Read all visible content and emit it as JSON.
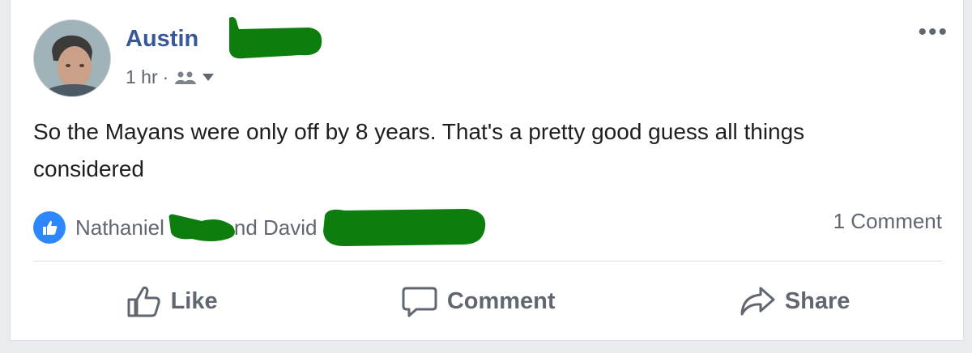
{
  "post": {
    "author": "Austin",
    "time": "1 hr",
    "separator": "·",
    "audience_icon": "friends-icon",
    "text": "So the Mayans were only off by 8 years. That's a pretty good guess all things considered",
    "more_icon": "more-options-icon",
    "more_glyph": "•••"
  },
  "reactions": {
    "icon": "like-reaction-icon",
    "part1": "Nathaniel",
    "part2": "nd David",
    "comment_count": "1 Comment"
  },
  "actions": {
    "like": "Like",
    "comment": "Comment",
    "share": "Share"
  },
  "colors": {
    "author": "#385898",
    "redaction": "#0d7d0d",
    "like_blue": "#2d88ff",
    "muted": "#606770"
  }
}
